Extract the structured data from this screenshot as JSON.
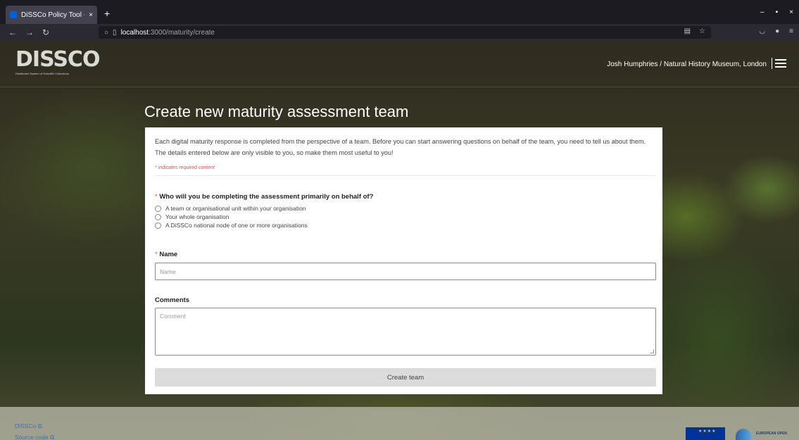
{
  "browser": {
    "tab_title": "DiSSCo Policy Tool - Crea",
    "new_tab": "+",
    "tab_close": "×",
    "url_host": "localhost",
    "url_path": ":3000/maturity/create",
    "win_min": "–",
    "win_max": "▪",
    "win_close": "×"
  },
  "header": {
    "logo_text": "DISSCO",
    "logo_subtitle": "Distributed System of Scientific Collections",
    "user": "Josh Humphries / Natural History Museum, London"
  },
  "main": {
    "title": "Create new maturity assessment team",
    "intro": "Each digital maturity response is completed from the perspective of a team. Before you can start answering questions on behalf of the team, you need to tell us about them. The details entered below are only visible to you, so make them most useful to you!",
    "required_note": "* indicates required content",
    "required_star": "*",
    "question": "Who will you be completing the assessment primarily on behalf of?",
    "options": [
      "A team or organisational unit within your organisation",
      "Your whole organisation",
      "A DiSSCo national node of one or more organisations"
    ],
    "name_label": "Name",
    "name_placeholder": "Name",
    "comments_label": "Comments",
    "comments_placeholder": "Comment",
    "submit_label": "Create team"
  },
  "footer": {
    "links": [
      "DiSSCo",
      "Source code"
    ],
    "eosc_text": "EUROPEAN OPEN"
  }
}
